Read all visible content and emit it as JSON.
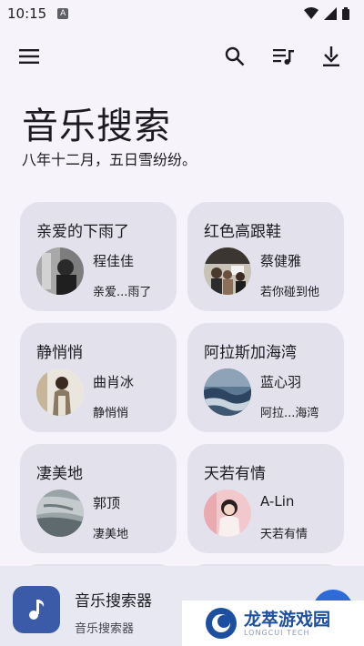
{
  "status_bar": {
    "time": "10:15",
    "notification_icon": "A"
  },
  "toolbar": {
    "menu_icon": "menu-icon",
    "search_icon": "search-icon",
    "queue_icon": "playlist-icon",
    "download_icon": "download-icon"
  },
  "header": {
    "title": "音乐搜索",
    "subtitle": "八年十二月，五日雪纷纷。"
  },
  "cards": [
    {
      "title": "亲爱的下雨了",
      "artist": "程佳佳",
      "album": "亲爱...雨了"
    },
    {
      "title": "红色高跟鞋",
      "artist": "蔡健雅",
      "album": "若你碰到他"
    },
    {
      "title": "静悄悄",
      "artist": "曲肖冰",
      "album": "静悄悄"
    },
    {
      "title": "阿拉斯加海湾",
      "artist": "蓝心羽",
      "album": "阿拉...海湾"
    },
    {
      "title": "凄美地",
      "artist": "郭顶",
      "album": "凄美地"
    },
    {
      "title": "天若有情",
      "artist": "A-Lin",
      "album": "天若有情"
    }
  ],
  "now_playing": {
    "title": "音乐搜索器",
    "subtitle": "音乐搜索器"
  },
  "watermark": {
    "main": "龙萃游戏园",
    "sub": "LONGCUI TECH"
  },
  "colors": {
    "background": "#f6f4fa",
    "card": "#e3e2ec",
    "accent": "#3b5ba9"
  }
}
